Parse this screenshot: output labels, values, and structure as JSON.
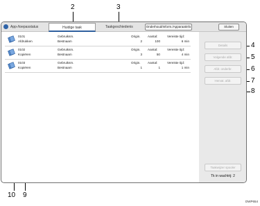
{
  "callouts": {
    "c2": "2",
    "c3": "3",
    "c4": "4",
    "c5": "5",
    "c6": "6",
    "c7": "7",
    "c8": "8",
    "c9": "9",
    "c10": "10"
  },
  "tabs": {
    "app_status": "App-/toepasstatus",
    "current_job": "Huidige taak",
    "job_history": "Taakgeschiedenis",
    "maintenance": "Onderhoud/Inform./Apparaatinfo",
    "close": "Sluiten"
  },
  "jobs": [
    {
      "id": "0101",
      "name": "Afdrukken",
      "used_label": "Gebruiksm.",
      "used_value": "Bestnaam",
      "orig_label": "Origin.",
      "orig_value": "2",
      "qty_label": "Aantal:",
      "qty_value": "100",
      "time_label": "Vereiste tijd:",
      "time_value": "6 min"
    },
    {
      "id": "0102",
      "name": "Kopiëren",
      "used_label": "Gebruiksm.",
      "used_value": "Bestnaam",
      "orig_label": "Origin.",
      "orig_value": "3",
      "qty_label": "Aantal:",
      "qty_value": "50",
      "time_label": "Vereiste tijd:",
      "time_value": "4 min"
    },
    {
      "id": "0103",
      "name": "Kopiëren",
      "used_label": "Gebruiksm.",
      "used_value": "Bestnaam",
      "orig_label": "Origin.",
      "orig_value": "1",
      "qty_label": "Aantal:",
      "qty_value": "1",
      "time_label": "Vereiste tijd:",
      "time_value": "1 min"
    }
  ],
  "side": {
    "details": "Details",
    "next_job": "Volgende afdr.",
    "stop_printing": "Afdr. onderbr.",
    "resume_printing": "Hervat. afdr.",
    "job_spooler": "Taakwijzer spooler",
    "waiting": "Tk in wachtrij:  2"
  },
  "footer_code": "DWP654",
  "colors": {
    "accent": "#2e5f9e",
    "panel": "#e9e9e9",
    "tabbar": "#e4e4e4",
    "disabled_text": "#a9a9a9"
  }
}
